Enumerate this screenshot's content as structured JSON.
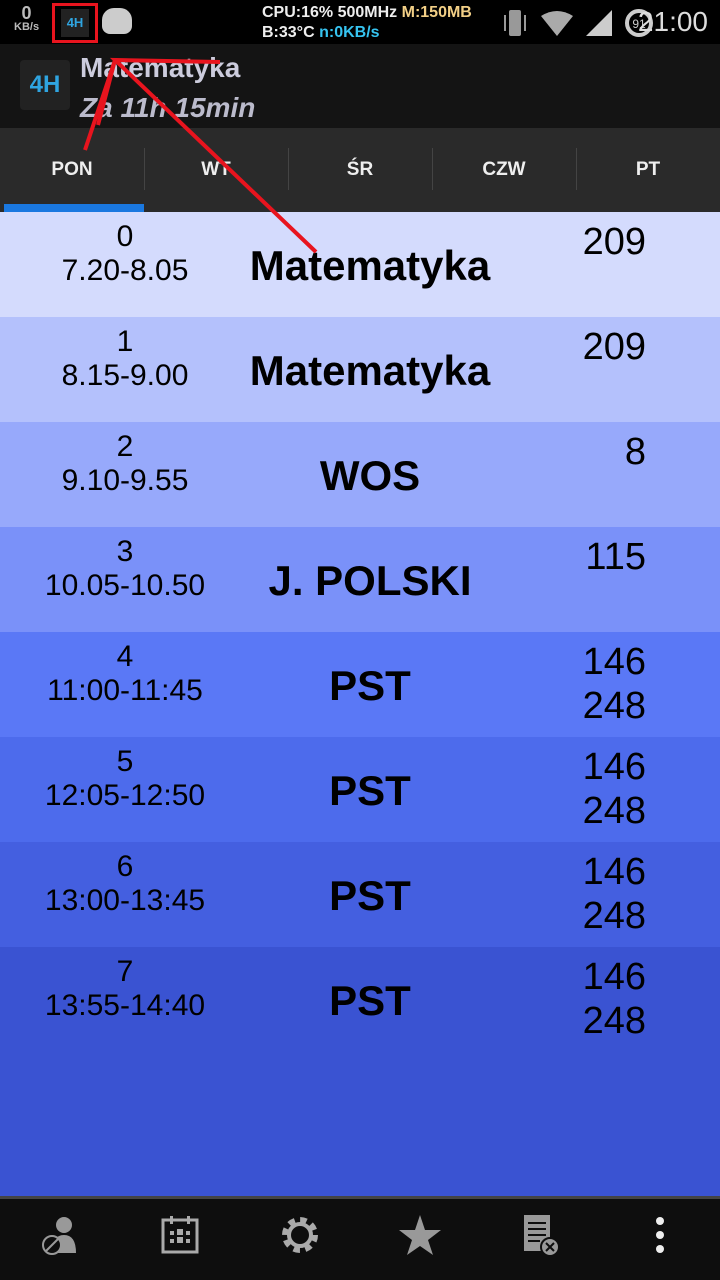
{
  "status": {
    "net_value": "0",
    "net_unit": "KB/s",
    "app_icon": "4H",
    "cpu": "CPU:16% 500MHz",
    "mem": "M:150MB",
    "temp": "B:33°C",
    "net": "n:0KB/s",
    "battery": "91",
    "time": "21:00"
  },
  "header": {
    "logo": "4H",
    "title": "Matematyka",
    "subtitle": "Za 11h 15min"
  },
  "tabs": [
    {
      "label": "PON"
    },
    {
      "label": "WT"
    },
    {
      "label": "ŚR"
    },
    {
      "label": "CZW"
    },
    {
      "label": "PT"
    }
  ],
  "lessons": [
    {
      "num": "0",
      "time": "7.20-8.05",
      "subject": "Matematyka",
      "room": "209",
      "color": "#d4dbfd"
    },
    {
      "num": "1",
      "time": "8.15-9.00",
      "subject": "Matematyka",
      "room": "209",
      "color": "#b4c1fc"
    },
    {
      "num": "2",
      "time": "9.10-9.55",
      "subject": "WOS",
      "room": "8",
      "color": "#97a9fb"
    },
    {
      "num": "3",
      "time": "10.05-10.50",
      "subject": "J. POLSKI",
      "room": "115",
      "color": "#7a91f9"
    },
    {
      "num": "4",
      "time": "11:00-11:45",
      "subject": "PST",
      "room": "146\n248",
      "color": "#5a78f6"
    },
    {
      "num": "5",
      "time": "12:05-12:50",
      "subject": "PST",
      "room": "146\n248",
      "color": "#4d6bec"
    },
    {
      "num": "6",
      "time": "13:00-13:45",
      "subject": "PST",
      "room": "146\n248",
      "color": "#445fe0"
    },
    {
      "num": "7",
      "time": "13:55-14:40",
      "subject": "PST",
      "room": "146\n248",
      "color": "#3a53d2"
    }
  ],
  "bottom_icons": [
    "blocked-user-icon",
    "calendar-icon",
    "gear-icon",
    "star-icon",
    "list-delete-icon",
    "overflow-menu-icon"
  ]
}
